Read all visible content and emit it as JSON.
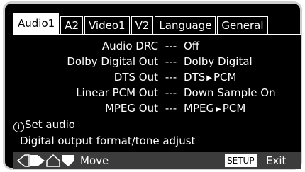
{
  "tabs": [
    {
      "label": "Audio1"
    },
    {
      "label": "A2"
    },
    {
      "label": "Video1"
    },
    {
      "label": "V2"
    },
    {
      "label": "Language"
    },
    {
      "label": "General"
    }
  ],
  "settings": [
    {
      "label": "Audio DRC",
      "separator": "---",
      "value": "Off"
    },
    {
      "label": "Dolby Digital Out",
      "separator": "---",
      "value": "Dolby Digital"
    },
    {
      "label": "DTS Out",
      "separator": "---",
      "value_from": "DTS",
      "value_to": "PCM"
    },
    {
      "label": "Linear PCM Out",
      "separator": "---",
      "value": "Down Sample On"
    },
    {
      "label": "MPEG Out",
      "separator": "---",
      "value_from": "MPEG",
      "value_to": "PCM"
    }
  ],
  "info": {
    "icon": "info-icon",
    "title": "Set audio",
    "description": "Digital output format/tone adjust"
  },
  "footer": {
    "move_label": "Move",
    "setup_key": "SETUP",
    "exit_label": "Exit"
  }
}
